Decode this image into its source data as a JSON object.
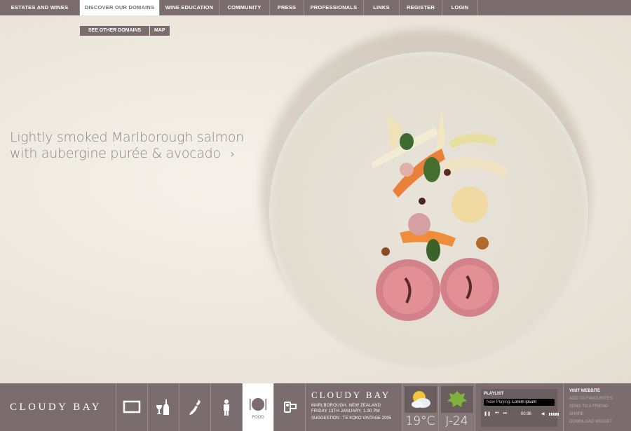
{
  "topnav": {
    "items": [
      {
        "label": "ESTATES AND WINES"
      },
      {
        "label": "DISCOVER OUR DOMAINS"
      },
      {
        "label": "WINE EDUCATION"
      },
      {
        "label": "COMMUNITY"
      },
      {
        "label": "PRESS"
      },
      {
        "label": "PROFESSIONALS"
      },
      {
        "label": "LINKS"
      },
      {
        "label": "REGISTER"
      },
      {
        "label": "LOGIN"
      }
    ],
    "active_index": 1
  },
  "subnav": {
    "see_other": "SEE OTHER DOMAINS",
    "map": "MAP"
  },
  "hero": {
    "caption_line1": "Lightly smoked Marlborough salmon",
    "caption_line2": "with aubergine purée & avocado",
    "arrow": "›"
  },
  "bottombar": {
    "logo": "CLOUDY BAY",
    "icons": [
      {
        "name": "monitor-icon"
      },
      {
        "name": "wine-bottle-glass-icon"
      },
      {
        "name": "new-zealand-map-icon"
      },
      {
        "name": "person-icon"
      },
      {
        "name": "food-plate-icon",
        "label": "FOOD"
      },
      {
        "name": "video-camera-icon"
      }
    ],
    "info": {
      "title": "CLOUDY BAY",
      "location": "MARLBOROUGH, NEW ZEALAND",
      "datetime": "FRIDAY 13TH JANUARY, 1.30 PM",
      "suggestion": "SUGGESTION : TE KOKO VINTAGE 2005"
    },
    "weather": {
      "value": "19°C",
      "icon": "partly-cloudy-icon"
    },
    "countdown": {
      "value": "J-24",
      "icon": "grape-leaf-icon"
    },
    "player": {
      "title": "PLAYLIST",
      "now_playing_label": "Now Playing:",
      "track": "Lorem ipsum",
      "time": "00:36"
    },
    "links": {
      "visit": "VISIT WEBSITE",
      "favourites": "ADD TO FAVOURITES",
      "friend": "SEND TO A FRIEND",
      "share": "SHARE",
      "download": "DOWNLOAD WIDGET"
    }
  },
  "colors": {
    "bar": "#7b6d6d",
    "background": "#f0ebe3",
    "caption": "#8c8686"
  }
}
